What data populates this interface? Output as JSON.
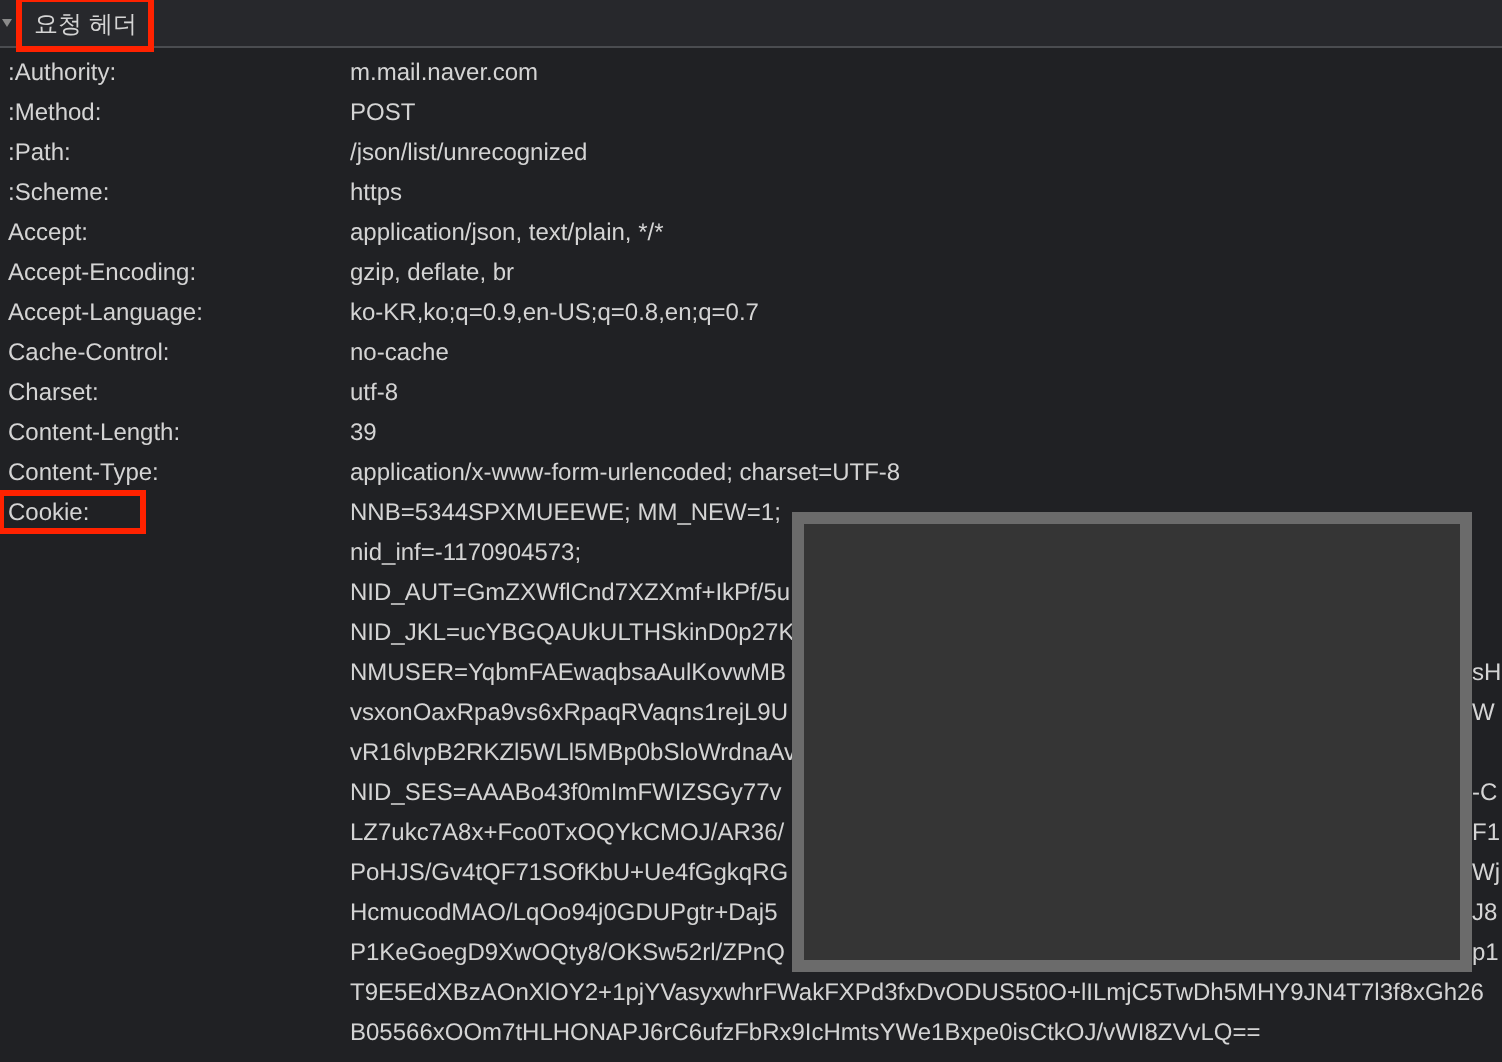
{
  "section": {
    "title": "요청 헤더",
    "expanded": true,
    "highlighted": true
  },
  "headers": [
    {
      "name": ":Authority:",
      "value": "m.mail.naver.com",
      "highlighted": false
    },
    {
      "name": ":Method:",
      "value": "POST",
      "highlighted": false
    },
    {
      "name": ":Path:",
      "value": "/json/list/unrecognized",
      "highlighted": false
    },
    {
      "name": ":Scheme:",
      "value": "https",
      "highlighted": false
    },
    {
      "name": "Accept:",
      "value": "application/json, text/plain, */*",
      "highlighted": false
    },
    {
      "name": "Accept-Encoding:",
      "value": "gzip, deflate, br",
      "highlighted": false
    },
    {
      "name": "Accept-Language:",
      "value": "ko-KR,ko;q=0.9,en-US;q=0.8,en;q=0.7",
      "highlighted": false
    },
    {
      "name": "Cache-Control:",
      "value": "no-cache",
      "highlighted": false
    },
    {
      "name": "Charset:",
      "value": "utf-8",
      "highlighted": false
    },
    {
      "name": "Content-Length:",
      "value": "39",
      "highlighted": false
    },
    {
      "name": "Content-Type:",
      "value": "application/x-www-form-urlencoded; charset=UTF-8",
      "highlighted": false
    }
  ],
  "cookie": {
    "name": "Cookie:",
    "highlighted": true,
    "lines": [
      {
        "left": "NNB=5344SPXMUEEWE; MM_NEW=1;"
      },
      {
        "left": "nid_inf=-1170904573;"
      },
      {
        "left": "NID_AUT=GmZXWflCnd7XZXmf+IkPf/5u"
      },
      {
        "left": "NID_JKL=ucYBGQAUkULTHSkinD0p27K"
      },
      {
        "left": "NMUSER=YqbmFAEwaqbsaAulKovwMB",
        "right": "sH"
      },
      {
        "left": "vsxonOaxRpa9vs6xRpaqRVaqns1rejL9U",
        "right": "W"
      },
      {
        "left": "vR16lvpB2RKZl5WLl5MBp0bSloWrdnaAv"
      },
      {
        "left": "NID_SES=AAABo43f0mImFWIZSGy77v",
        "right": "-C"
      },
      {
        "left": "LZ7ukc7A8x+Fco0TxOQYkCMOJ/AR36/",
        "right": "F1"
      },
      {
        "left": "PoHJS/Gv4tQF71SOfKbU+Ue4fGgkqRG",
        "right": "Wj"
      },
      {
        "left": "HcmucodMAO/LqOo94j0GDUPgtr+Daj5",
        "right": "J8"
      },
      {
        "left": "P1KeGoegD9XwOQty8/OKSw52rl/ZPnQ",
        "right": "p1"
      },
      {
        "left": "T9E5EdXBzAOnXlOY2+1pjYVasyxwhrFWakFXPd3fxDvODUS5t0O+lILmjC5TwDh5MHY9JN4T7l3f8xGh26"
      },
      {
        "left": "B05566xOOm7tHLHONAPJ6rC6ufzFbRx9IcHmtsYWe1Bxpe0isCtkOJ/vWI8ZVvLQ=="
      }
    ]
  }
}
